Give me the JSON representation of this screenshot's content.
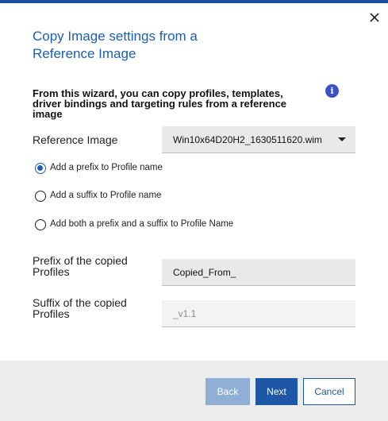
{
  "dialog": {
    "title_line1": "Copy Image settings from a",
    "title_line2": "Reference Image",
    "intro_line1": "From this wizard, you can copy profiles, templates,",
    "intro_line2": "driver bindings and targeting rules from a reference",
    "intro_line3": "image",
    "info_icon_glyph": "i"
  },
  "reference_image": {
    "label": "Reference Image",
    "selected": "Win10x64D20H2_1630511620.wim"
  },
  "options": [
    {
      "label": "Add a prefix to Profile name",
      "checked": true
    },
    {
      "label": "Add a suffix to Profile name",
      "checked": false
    },
    {
      "label": "Add both a prefix and a suffix to Profile Name",
      "checked": false
    }
  ],
  "prefix": {
    "label_line1": "Prefix of the copied",
    "label_line2": "Profiles",
    "value": "Copied_From_"
  },
  "suffix": {
    "label_line1": "Suffix of the copied",
    "label_line2": "Profiles",
    "placeholder": "_v1.1"
  },
  "buttons": {
    "back": "Back",
    "next": "Next",
    "cancel": "Cancel"
  },
  "colors": {
    "accent": "#1b5fb0",
    "primary_button": "#1e57a6",
    "disabled_button": "#8fb0d4",
    "info_icon": "#3b52c4"
  }
}
